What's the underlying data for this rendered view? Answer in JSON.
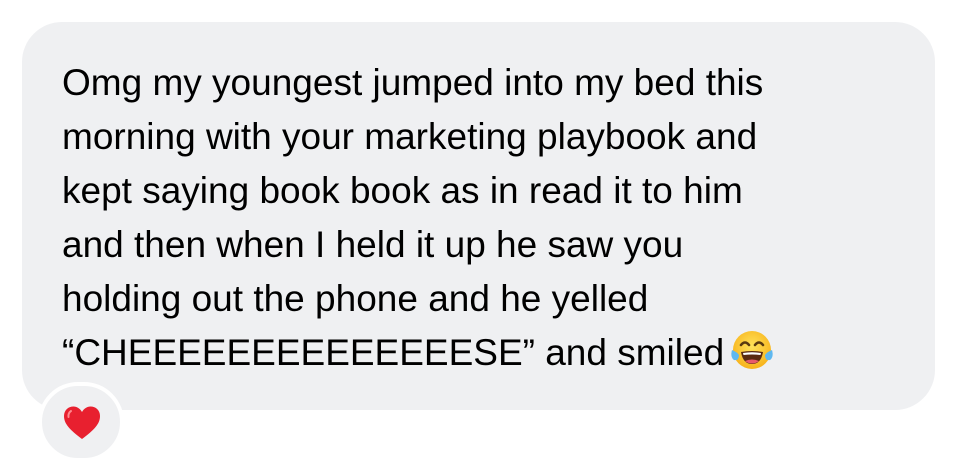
{
  "message": {
    "lines": [
      "Omg my youngest jumped into my bed this",
      "morning with your marketing playbook and",
      "kept saying book book as in read it to him",
      "and then when I held it up he saw you",
      "holding out the phone and he yelled",
      "“CHEEEEEEEEEEEEEESE” and smiled"
    ],
    "emoji": "face-with-tears-of-joy"
  },
  "reaction": {
    "icon": "red-heart",
    "color": "#e8202f"
  },
  "colors": {
    "bubble_background": "#eff0f2",
    "page_background": "#ffffff",
    "text": "#000000"
  }
}
